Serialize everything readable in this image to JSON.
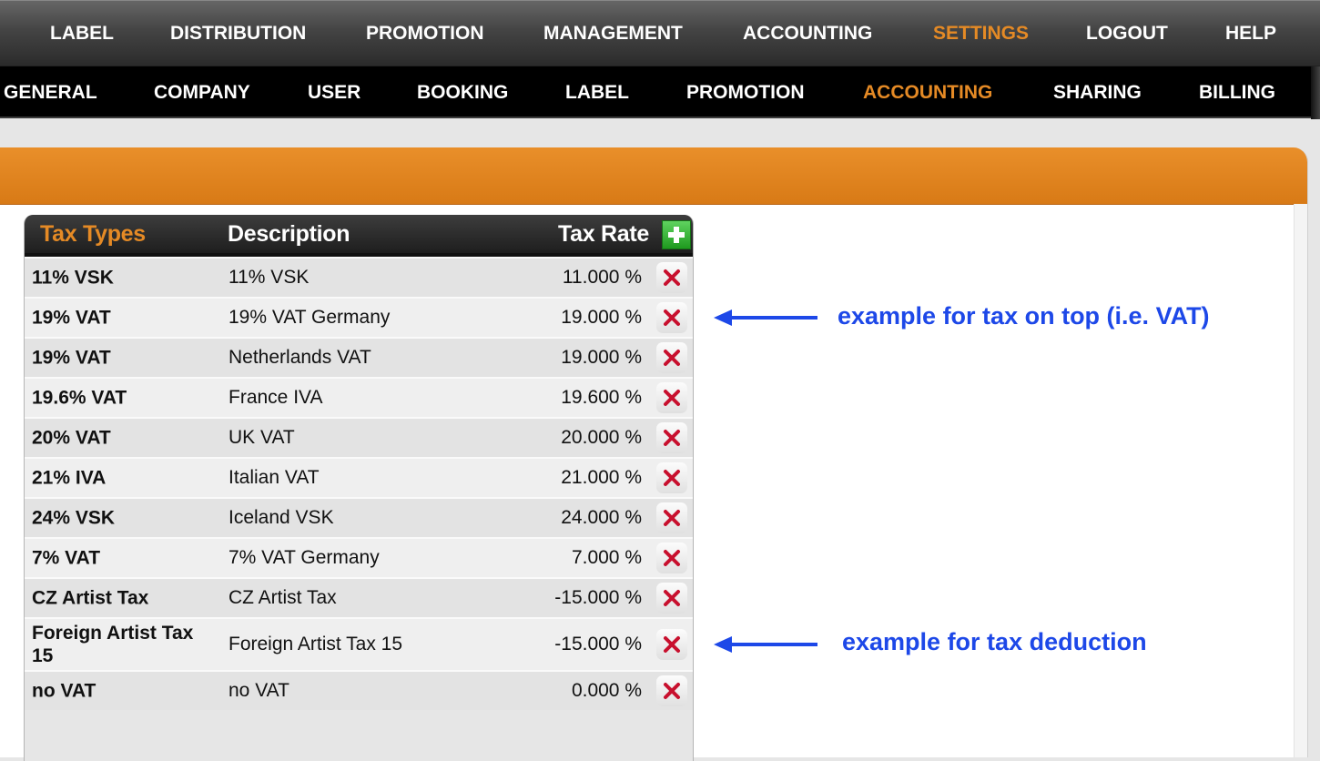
{
  "top_nav": {
    "items": [
      {
        "label": "LABEL",
        "active": false
      },
      {
        "label": "DISTRIBUTION",
        "active": false
      },
      {
        "label": "PROMOTION",
        "active": false
      },
      {
        "label": "MANAGEMENT",
        "active": false
      },
      {
        "label": "ACCOUNTING",
        "active": false
      },
      {
        "label": "SETTINGS",
        "active": true
      },
      {
        "label": "LOGOUT",
        "active": false
      },
      {
        "label": "HELP",
        "active": false
      }
    ]
  },
  "sub_nav": {
    "items": [
      {
        "label": "GENERAL",
        "active": false
      },
      {
        "label": "COMPANY",
        "active": false
      },
      {
        "label": "USER",
        "active": false
      },
      {
        "label": "BOOKING",
        "active": false
      },
      {
        "label": "LABEL",
        "active": false
      },
      {
        "label": "PROMOTION",
        "active": false
      },
      {
        "label": "ACCOUNTING",
        "active": true
      },
      {
        "label": "SHARING",
        "active": false
      },
      {
        "label": "BILLING",
        "active": false
      }
    ]
  },
  "tax_table": {
    "headers": {
      "type": "Tax Types",
      "description": "Description",
      "rate": "Tax Rate"
    },
    "add_icon": "plus-icon",
    "delete_icon": "x-icon",
    "rows": [
      {
        "type": "11% VSK",
        "description": "11% VSK",
        "rate": "11.000 %"
      },
      {
        "type": "19% VAT",
        "description": "19% VAT Germany",
        "rate": "19.000 %"
      },
      {
        "type": "19% VAT",
        "description": "Netherlands VAT",
        "rate": "19.000 %"
      },
      {
        "type": "19.6% VAT",
        "description": "France IVA",
        "rate": "19.600 %"
      },
      {
        "type": "20% VAT",
        "description": "UK VAT",
        "rate": "20.000 %"
      },
      {
        "type": "21% IVA",
        "description": "Italian VAT",
        "rate": "21.000 %"
      },
      {
        "type": "24% VSK",
        "description": "Iceland VSK",
        "rate": "24.000 %"
      },
      {
        "type": "7% VAT",
        "description": "7% VAT Germany",
        "rate": "7.000 %"
      },
      {
        "type": "CZ Artist Tax",
        "description": "CZ Artist Tax",
        "rate": "-15.000 %"
      },
      {
        "type": "Foreign Artist Tax 15",
        "description": "Foreign Artist Tax 15",
        "rate": "-15.000 %"
      },
      {
        "type": "no VAT",
        "description": "no VAT",
        "rate": "0.000 %"
      }
    ]
  },
  "annotations": {
    "tax_on_top": "example for tax on top (i.e. VAT)",
    "tax_deduction": "example for tax deduction"
  },
  "colors": {
    "accent_orange": "#e58a25",
    "annotation_blue": "#1d48e8",
    "delete_red": "#c8102e",
    "add_green": "#2fae2f"
  }
}
